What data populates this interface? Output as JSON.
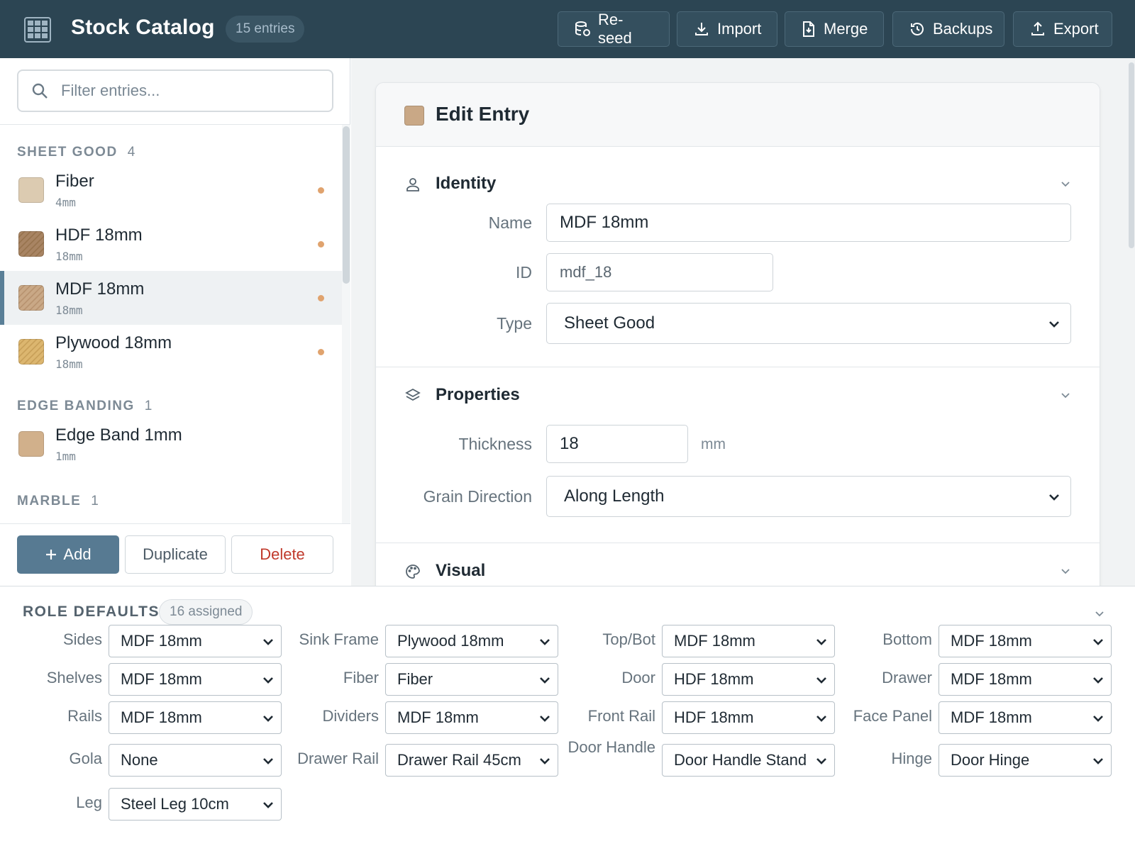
{
  "header": {
    "title": "Stock Catalog",
    "entry_count": "15 entries",
    "buttons": [
      {
        "label": "Re-seed",
        "icon": "database-refresh-icon"
      },
      {
        "label": "Import",
        "icon": "download-icon"
      },
      {
        "label": "Merge",
        "icon": "file-merge-icon"
      },
      {
        "label": "Backups",
        "icon": "history-icon"
      },
      {
        "label": "Export",
        "icon": "upload-icon"
      }
    ]
  },
  "sidebar": {
    "search_placeholder": "Filter entries...",
    "groups": [
      {
        "name": "SHEET GOOD",
        "count": "4",
        "items": [
          {
            "name": "Fiber",
            "sub": "4mm",
            "color": "#dccbb1",
            "hatched": false,
            "selected": false
          },
          {
            "name": "HDF 18mm",
            "sub": "18mm",
            "color": "#a88463",
            "hatched": true,
            "selected": false
          },
          {
            "name": "MDF 18mm",
            "sub": "18mm",
            "color": "#c9a886",
            "hatched": true,
            "selected": true
          },
          {
            "name": "Plywood 18mm",
            "sub": "18mm",
            "color": "#dcb66f",
            "hatched": true,
            "selected": false
          }
        ]
      },
      {
        "name": "EDGE BANDING",
        "count": "1",
        "items": [
          {
            "name": "Edge Band 1mm",
            "sub": "1mm",
            "color": "#d1b08b",
            "hatched": false,
            "selected": false
          }
        ]
      },
      {
        "name": "MARBLE",
        "count": "1",
        "items": []
      }
    ],
    "add_label": "Add",
    "duplicate_label": "Duplicate",
    "delete_label": "Delete"
  },
  "editor": {
    "title": "Edit Entry",
    "swatch_color": "#c9a886",
    "identity": {
      "title": "Identity",
      "name_label": "Name",
      "name_value": "MDF 18mm",
      "id_label": "ID",
      "id_value": "mdf_18",
      "type_label": "Type",
      "type_value": "Sheet Good"
    },
    "properties": {
      "title": "Properties",
      "thickness_label": "Thickness",
      "thickness_value": "18",
      "thickness_unit": "mm",
      "grain_label": "Grain Direction",
      "grain_value": "Along Length"
    },
    "visual": {
      "title": "Visual"
    }
  },
  "roles": {
    "title": "ROLE DEFAULTS",
    "assigned": "16 assigned",
    "rows": [
      [
        {
          "label": "Sides",
          "value": "MDF 18mm"
        },
        {
          "label": "Sink Frame",
          "value": "Plywood 18mm"
        },
        {
          "label": "Top/Bot",
          "value": "MDF 18mm"
        },
        {
          "label": "Bottom",
          "value": "MDF 18mm"
        }
      ],
      [
        {
          "label": "Shelves",
          "value": "MDF 18mm"
        },
        {
          "label": "Fiber",
          "value": "Fiber"
        },
        {
          "label": "Door",
          "value": "HDF 18mm"
        },
        {
          "label": "Drawer",
          "value": "MDF 18mm"
        }
      ],
      [
        {
          "label": "Rails",
          "value": "MDF 18mm"
        },
        {
          "label": "Dividers",
          "value": "MDF 18mm"
        },
        {
          "label": "Front Rail",
          "value": "HDF 18mm"
        },
        {
          "label": "Face Panel",
          "value": "MDF 18mm"
        }
      ],
      [
        {
          "label": "Gola",
          "value": "None"
        },
        {
          "label": "Drawer Rail",
          "value": "Drawer Rail 45cm"
        },
        {
          "label": "Door Handle",
          "value": "Door Handle Stand"
        },
        {
          "label": "Hinge",
          "value": "Door Hinge"
        }
      ],
      [
        {
          "label": "Leg",
          "value": "Steel Leg 10cm"
        }
      ]
    ]
  }
}
